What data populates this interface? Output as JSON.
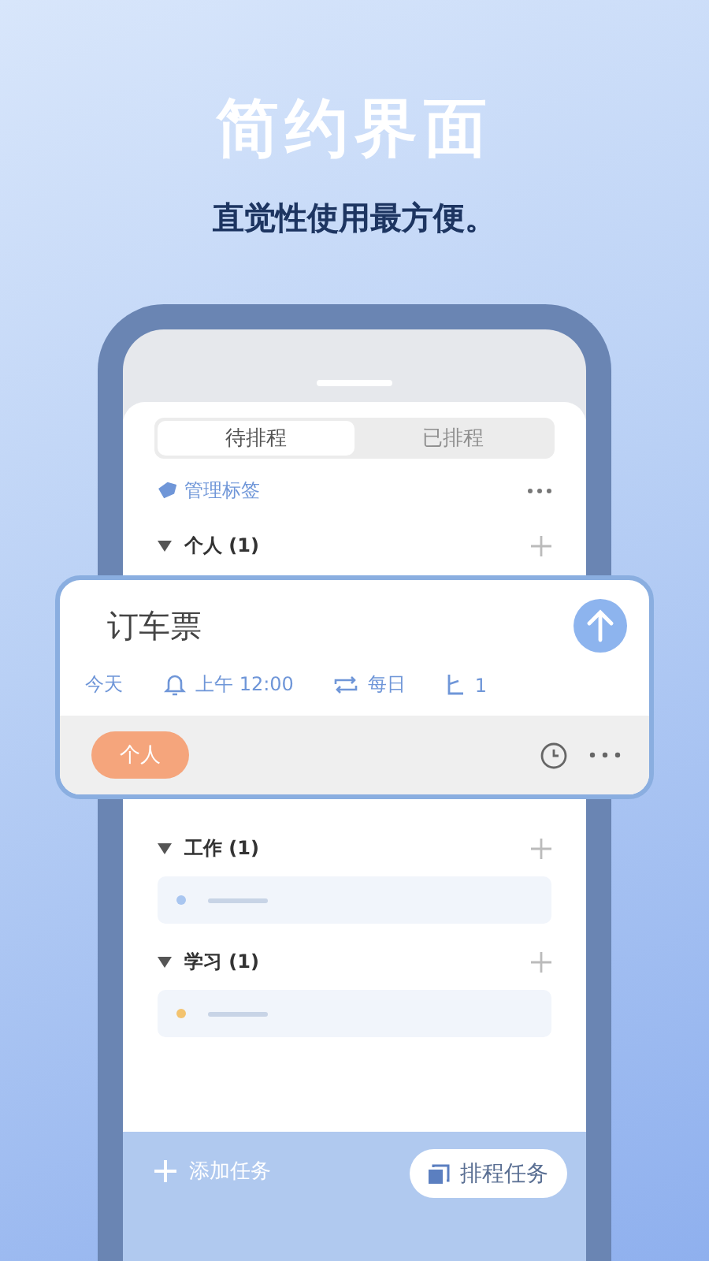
{
  "headline": "简约界面",
  "subtitle": "直觉性使用最方便。",
  "tabs": [
    {
      "label": "待排程",
      "selected": true
    },
    {
      "label": "已排程",
      "selected": false
    }
  ],
  "manage_tags": "管理标签",
  "groups": [
    {
      "name": "个人 (1)",
      "expanded": true
    },
    {
      "name": "工作 (1)",
      "expanded": true,
      "items": [
        {
          "color": "#a9c6f0"
        }
      ]
    },
    {
      "name": "学习 (1)",
      "expanded": true,
      "items": [
        {
          "color": "#f3c36f"
        }
      ]
    }
  ],
  "task_card": {
    "title": "订车票",
    "date": "今天",
    "reminder": "上午 12:00",
    "repeat": "每日",
    "subtasks": "1",
    "tag": "个人"
  },
  "bottom_bar": {
    "add_task": "添加任务",
    "schedule": "排程任务"
  }
}
